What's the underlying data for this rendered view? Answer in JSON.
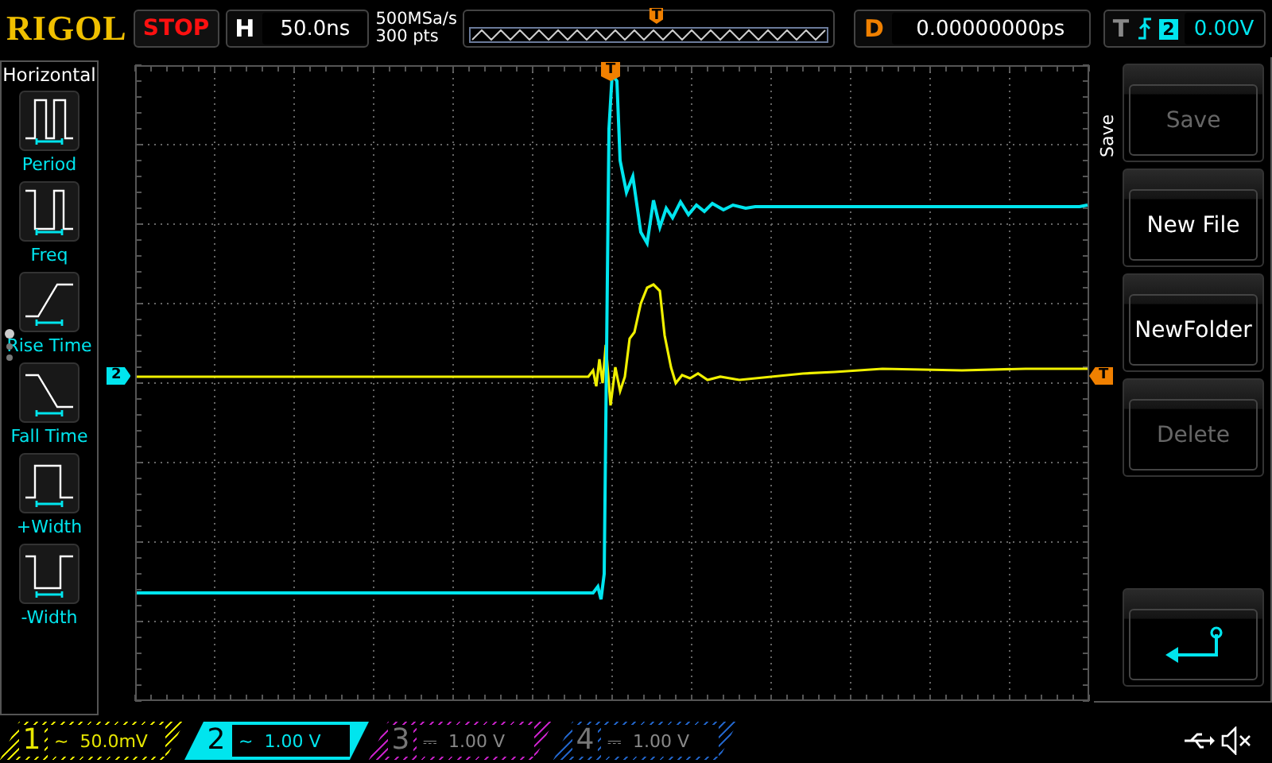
{
  "brand": "RIGOL",
  "run_state": "STOP",
  "horizontal": {
    "label": "H",
    "timebase": "50.0ns"
  },
  "acquisition": {
    "sample_rate": "500MSa/s",
    "memory_depth": "300 pts"
  },
  "overview": {
    "trigger_marker": "T"
  },
  "delay": {
    "label": "D",
    "value": "0.00000000ps"
  },
  "trigger": {
    "label": "T",
    "source": "2",
    "level": "0.00V"
  },
  "left_menu": {
    "title": "Horizontal",
    "items": [
      {
        "label": "Period",
        "kind": "period"
      },
      {
        "label": "Freq",
        "kind": "freq"
      },
      {
        "label": "Rise Time",
        "kind": "rise"
      },
      {
        "label": "Fall Time",
        "kind": "fall"
      },
      {
        "label": "+Width",
        "kind": "pwidth"
      },
      {
        "label": "-Width",
        "kind": "nwidth"
      }
    ],
    "pages": [
      {
        "selected": true
      },
      {
        "selected": false
      },
      {
        "selected": false
      }
    ]
  },
  "plot": {
    "channel_marker": "2",
    "level_marker": "T",
    "position_marker": "T"
  },
  "save_menu": {
    "title": "Save",
    "buttons": [
      {
        "kind": "text",
        "label": "Save",
        "disabled": true
      },
      {
        "kind": "text",
        "label": "New File",
        "disabled": false
      },
      {
        "kind": "text",
        "label": "NewFolder",
        "disabled": false
      },
      {
        "kind": "text",
        "label": "Delete",
        "disabled": true
      },
      {
        "kind": "back",
        "disabled": false
      }
    ]
  },
  "channels": [
    {
      "number": "1",
      "coupling": "~",
      "scale": "50.0mV",
      "color": "#e6e600",
      "enabled": true,
      "selected": false
    },
    {
      "number": "2",
      "coupling": "~",
      "scale": "1.00 V",
      "color": "#00e5ee",
      "enabled": true,
      "selected": true
    },
    {
      "number": "3",
      "coupling": "⎓",
      "scale": "1.00 V",
      "color": "#c020c0",
      "enabled": false,
      "selected": false
    },
    {
      "number": "4",
      "coupling": "⎓",
      "scale": "1.00 V",
      "color": "#2060c0",
      "enabled": false,
      "selected": false
    }
  ]
}
